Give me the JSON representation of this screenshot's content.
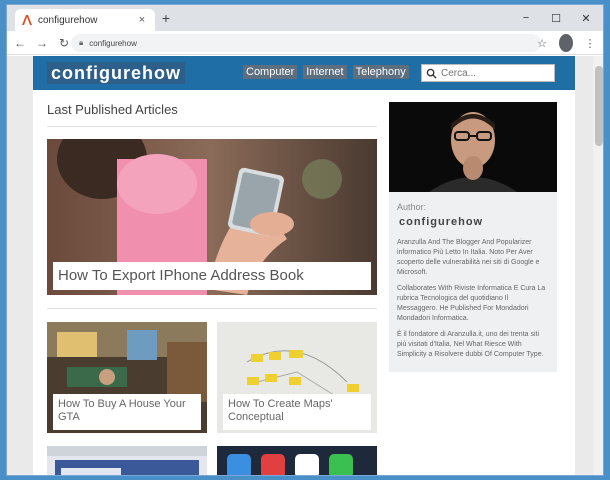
{
  "browser": {
    "tab_title": "configurehow",
    "tab_close": "×",
    "new_tab": "+",
    "url": "configurehow",
    "window_controls": [
      "−",
      "☐",
      "✕"
    ]
  },
  "site": {
    "logo": "configurehow",
    "nav": [
      "Computer",
      "Internet",
      "Telephony"
    ],
    "search_placeholder": "Cerca..."
  },
  "main": {
    "section_title": "Last Published Articles",
    "hero_title": "How To Export IPhone Address Book",
    "cards": [
      {
        "title": "How To Buy A House Your GTA"
      },
      {
        "title": "How To Create Maps' Conceptual"
      }
    ]
  },
  "sidebar": {
    "author_label": "Author:",
    "author_name": "configurehow",
    "bio": [
      "Aranzulla And The Blogger And Popularizer informatico Più Letto In Italia. Noto Per Aver scoperto delle vulnerabilità nei siti di Google e Microsoft.",
      "Collaborates With Riviste Informatica E Cura La rubrica Tecnologica del quotidiano Il Messaggero. He Published For Mondadori Mondadori Informatica.",
      "È il fondatore di Aranzulla.it, uno dei trenta siti più visitati d'Italia, Nel What Riesce With Simplicity a Risolvere dubbi Of Computer Type."
    ]
  },
  "colors": {
    "header_bg": "#1f6fa6",
    "page_bg": "#ffffff",
    "sidebar_bg": "#eef0f2"
  }
}
